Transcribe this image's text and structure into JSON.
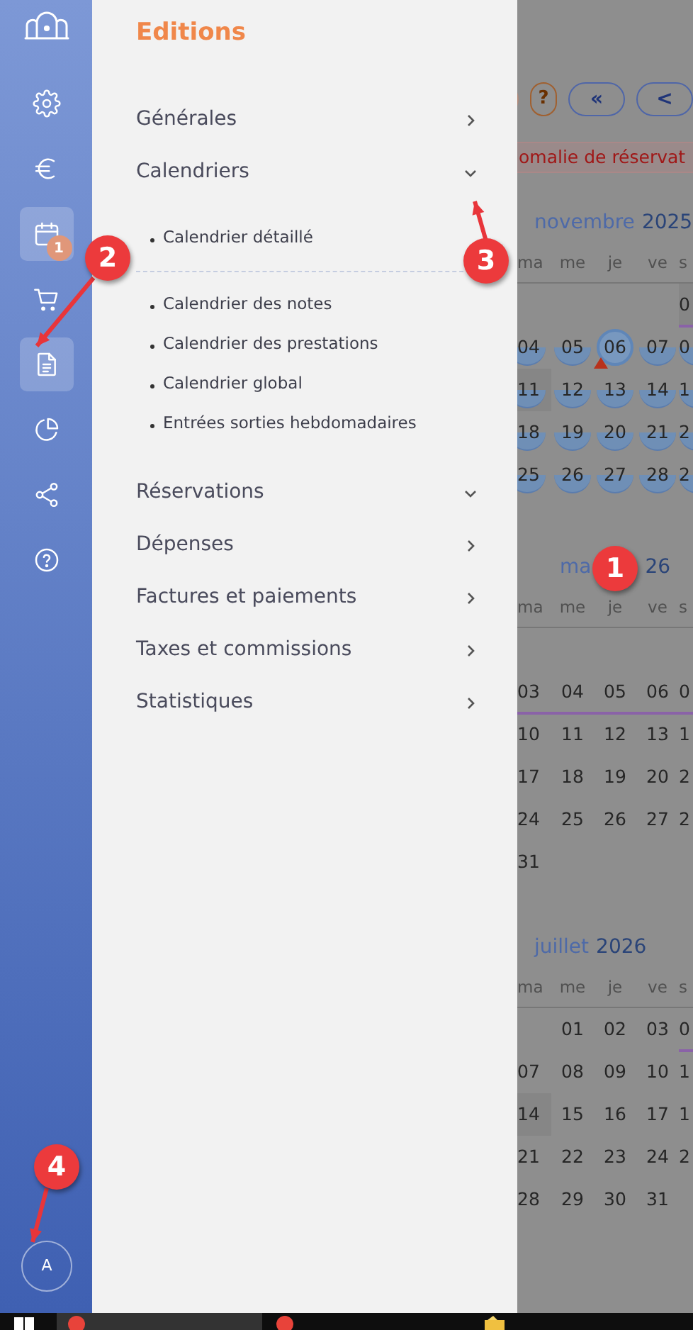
{
  "sidebar": {
    "items": [
      {
        "selected": false
      },
      {
        "selected": false
      },
      {
        "selected": false
      },
      {
        "selected": true,
        "badge": "1"
      },
      {
        "selected": false
      },
      {
        "selected": true
      },
      {
        "selected": false
      },
      {
        "selected": false
      },
      {
        "selected": false
      }
    ],
    "avatar": "A"
  },
  "menu": {
    "title": "Editions",
    "sections": [
      {
        "label": "Générales",
        "expanded": false
      },
      {
        "label": "Calendriers",
        "expanded": true,
        "children": [
          {
            "label": "Calendrier détaillé",
            "separator_after": true
          },
          {
            "label": "Calendrier des notes",
            "separator_after": false
          },
          {
            "label": "Calendrier des prestations",
            "separator_after": false
          },
          {
            "label": "Calendrier global",
            "separator_after": false
          },
          {
            "label": "Entrées sorties hebdomadaires",
            "separator_after": false
          }
        ]
      },
      {
        "label": "Réservations",
        "expanded": true
      },
      {
        "label": "Dépenses",
        "expanded": false
      },
      {
        "label": "Factures et paiements",
        "expanded": false
      },
      {
        "label": "Taxes et commissions",
        "expanded": false
      },
      {
        "label": "Statistiques",
        "expanded": false
      }
    ]
  },
  "calendar": {
    "toolbar": [
      {
        "kind": "blank"
      },
      {
        "kind": "help",
        "label": "?"
      },
      {
        "kind": "nav",
        "label": "«"
      },
      {
        "kind": "nav",
        "label": "<"
      }
    ],
    "banner": "omalie de réservat",
    "months": [
      {
        "month": "novembre",
        "year": "2025",
        "weekdays": [
          "ma",
          "me",
          "je",
          "ve",
          "s"
        ],
        "rows": [
          {
            "kind": "line_last",
            "cells": [
              {
                "kind": "empty"
              },
              {
                "kind": "empty"
              },
              {
                "kind": "empty"
              },
              {
                "kind": "empty"
              },
              {
                "text": "0",
                "kind": "shaded"
              }
            ]
          },
          {
            "kind": "plain",
            "cells": [
              {
                "text": "04",
                "kind": "booked"
              },
              {
                "text": "05",
                "kind": "booked"
              },
              {
                "text": "06",
                "kind": "today"
              },
              {
                "text": "07",
                "kind": "booked"
              },
              {
                "text": "0",
                "kind": "booked"
              }
            ]
          },
          {
            "kind": "plain",
            "cells": [
              {
                "text": "11",
                "kind": "shaded_booked"
              },
              {
                "text": "12",
                "kind": "booked"
              },
              {
                "text": "13",
                "kind": "booked"
              },
              {
                "text": "14",
                "kind": "booked"
              },
              {
                "text": "1",
                "kind": "booked"
              }
            ]
          },
          {
            "kind": "plain",
            "cells": [
              {
                "text": "18",
                "kind": "booked"
              },
              {
                "text": "19",
                "kind": "booked"
              },
              {
                "text": "20",
                "kind": "booked"
              },
              {
                "text": "21",
                "kind": "booked"
              },
              {
                "text": "2",
                "kind": "booked"
              }
            ]
          },
          {
            "kind": "plain",
            "cells": [
              {
                "text": "25",
                "kind": "booked"
              },
              {
                "text": "26",
                "kind": "booked"
              },
              {
                "text": "27",
                "kind": "booked"
              },
              {
                "text": "28",
                "kind": "booked"
              },
              {
                "text": "2",
                "kind": "booked"
              }
            ]
          }
        ]
      },
      {
        "month": "ma",
        "year": "26",
        "weekdays": [
          "ma",
          "me",
          "je",
          "ve",
          "s"
        ],
        "rows": [
          {
            "kind": "plain",
            "cells": [
              {
                "kind": "empty"
              },
              {
                "kind": "empty"
              },
              {
                "kind": "empty"
              },
              {
                "kind": "empty"
              },
              {
                "kind": "empty"
              }
            ]
          },
          {
            "kind": "line_full",
            "cells": [
              {
                "text": "03",
                "kind": "plain"
              },
              {
                "text": "04",
                "kind": "plain"
              },
              {
                "text": "05",
                "kind": "plain"
              },
              {
                "text": "06",
                "kind": "plain"
              },
              {
                "text": "0",
                "kind": "plain"
              }
            ]
          },
          {
            "kind": "plain",
            "cells": [
              {
                "text": "10",
                "kind": "plain"
              },
              {
                "text": "11",
                "kind": "plain"
              },
              {
                "text": "12",
                "kind": "plain"
              },
              {
                "text": "13",
                "kind": "plain"
              },
              {
                "text": "1",
                "kind": "plain"
              }
            ]
          },
          {
            "kind": "plain",
            "cells": [
              {
                "text": "17",
                "kind": "plain"
              },
              {
                "text": "18",
                "kind": "plain"
              },
              {
                "text": "19",
                "kind": "plain"
              },
              {
                "text": "20",
                "kind": "plain"
              },
              {
                "text": "2",
                "kind": "plain"
              }
            ]
          },
          {
            "kind": "plain",
            "cells": [
              {
                "text": "24",
                "kind": "plain"
              },
              {
                "text": "25",
                "kind": "plain"
              },
              {
                "text": "26",
                "kind": "plain"
              },
              {
                "text": "27",
                "kind": "plain"
              },
              {
                "text": "2",
                "kind": "plain"
              }
            ]
          },
          {
            "kind": "plain",
            "cells": [
              {
                "text": "31",
                "kind": "plain"
              },
              {
                "kind": "empty"
              },
              {
                "kind": "empty"
              },
              {
                "kind": "empty"
              },
              {
                "kind": "empty"
              }
            ]
          }
        ]
      },
      {
        "month": "juillet",
        "year": "2026",
        "weekdays": [
          "ma",
          "me",
          "je",
          "ve",
          "s"
        ],
        "rows": [
          {
            "kind": "line_last",
            "cells": [
              {
                "kind": "empty"
              },
              {
                "text": "01",
                "kind": "plain"
              },
              {
                "text": "02",
                "kind": "plain"
              },
              {
                "text": "03",
                "kind": "plain"
              },
              {
                "text": "0",
                "kind": "plain"
              }
            ]
          },
          {
            "kind": "plain",
            "cells": [
              {
                "text": "07",
                "kind": "plain"
              },
              {
                "text": "08",
                "kind": "plain"
              },
              {
                "text": "09",
                "kind": "plain"
              },
              {
                "text": "10",
                "kind": "plain"
              },
              {
                "text": "1",
                "kind": "plain"
              }
            ]
          },
          {
            "kind": "plain",
            "cells": [
              {
                "text": "14",
                "kind": "shaded"
              },
              {
                "text": "15",
                "kind": "plain"
              },
              {
                "text": "16",
                "kind": "plain"
              },
              {
                "text": "17",
                "kind": "plain"
              },
              {
                "text": "1",
                "kind": "plain"
              }
            ]
          },
          {
            "kind": "plain",
            "cells": [
              {
                "text": "21",
                "kind": "plain"
              },
              {
                "text": "22",
                "kind": "plain"
              },
              {
                "text": "23",
                "kind": "plain"
              },
              {
                "text": "24",
                "kind": "plain"
              },
              {
                "text": "2",
                "kind": "plain"
              }
            ]
          },
          {
            "kind": "plain",
            "cells": [
              {
                "text": "28",
                "kind": "plain"
              },
              {
                "text": "29",
                "kind": "plain"
              },
              {
                "text": "30",
                "kind": "plain"
              },
              {
                "text": "31",
                "kind": "plain"
              },
              {
                "kind": "empty"
              }
            ]
          }
        ]
      }
    ]
  },
  "annotations": [
    {
      "label": "1"
    },
    {
      "label": "2"
    },
    {
      "label": "3"
    },
    {
      "label": "4"
    }
  ]
}
